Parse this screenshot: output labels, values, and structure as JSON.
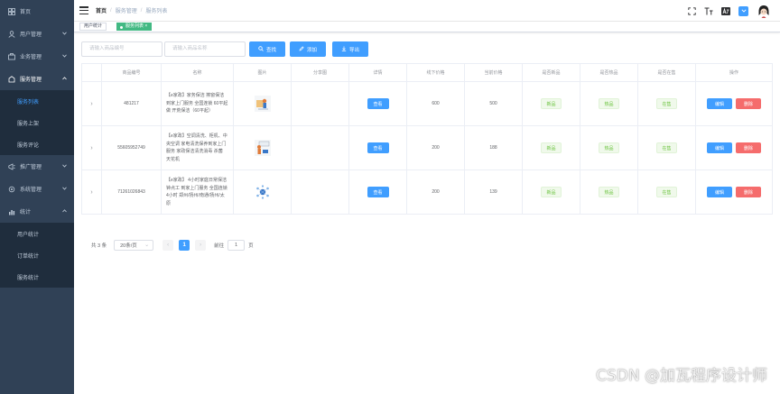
{
  "sidebar": {
    "items": [
      {
        "label": "首页",
        "icon": "dashboard-icon"
      },
      {
        "label": "用户管理",
        "icon": "user-icon",
        "arrow": "chevron-down-icon"
      },
      {
        "label": "业务管理",
        "icon": "briefcase-icon",
        "arrow": "chevron-down-icon"
      },
      {
        "label": "服务管理",
        "icon": "service-icon",
        "arrow": "chevron-up-icon"
      }
    ],
    "service_sub": [
      "服务列表",
      "服务上架",
      "服务评论"
    ],
    "items2": [
      {
        "label": "推广管理",
        "icon": "promo-icon"
      },
      {
        "label": "系统管理",
        "icon": "settings-icon"
      },
      {
        "label": "统计",
        "icon": "chart-icon"
      }
    ],
    "stats_sub": [
      "用户统计",
      "订单统计",
      "服务统计"
    ]
  },
  "breadcrumb": [
    "首页",
    "服务管理",
    "服务列表"
  ],
  "tags": {
    "first": "用户统计",
    "active": "服务列表"
  },
  "toolbar": {
    "id_placeholder": "请输入商品编号",
    "name_placeholder": "请输入商品名称",
    "search_label": "查找",
    "add_label": "添加",
    "export_label": "导出"
  },
  "table": {
    "headers": [
      "商品编号",
      "名称",
      "图片",
      "分享图",
      "详情",
      "线下价格",
      "当前价格",
      "是否新品",
      "是否热品",
      "是否在售",
      "操作"
    ],
    "view_label": "查看",
    "edit_label": "编辑",
    "delete_label": "删除",
    "rows": [
      {
        "id": "481217",
        "name": "【e家政】家务保洁 擦窗保洁到家上门服务 全国连锁 60平起做 开荒保洁（60平起）",
        "offline_price": "600",
        "price": "500",
        "is_new": "新品",
        "is_hot": "热品",
        "on_sale": "在售"
      },
      {
        "id": "55605952749",
        "name": "【e家政】空调清洗、柜机、中央空调 家电清洗保养到家上门服务 家政保洁清洗消毒 杀菌 天花机",
        "offline_price": "200",
        "price": "188",
        "is_new": "新品",
        "is_hot": "热品",
        "on_sale": "在售"
      },
      {
        "id": "71261026843",
        "name": "【e家政】 4小时家庭日常保洁 钟点工 到家上门服务 全国连锁 4小时 郑州/扬州/南通/扬州/太原",
        "offline_price": "200",
        "price": "139",
        "is_new": "新品",
        "is_hot": "热品",
        "on_sale": "在售"
      }
    ]
  },
  "pagination": {
    "total": "共 3 条",
    "page_size": "20条/页",
    "current_page": "1",
    "goto_label": "前往",
    "goto_value": "1",
    "page_suffix": "页"
  },
  "watermark": "CSDN @加瓦程序设计师",
  "colors": {
    "sidebar_bg": "#304156",
    "primary": "#409eff",
    "danger": "#f56c6c",
    "success": "#67c23a",
    "tag_active": "#42b983"
  }
}
